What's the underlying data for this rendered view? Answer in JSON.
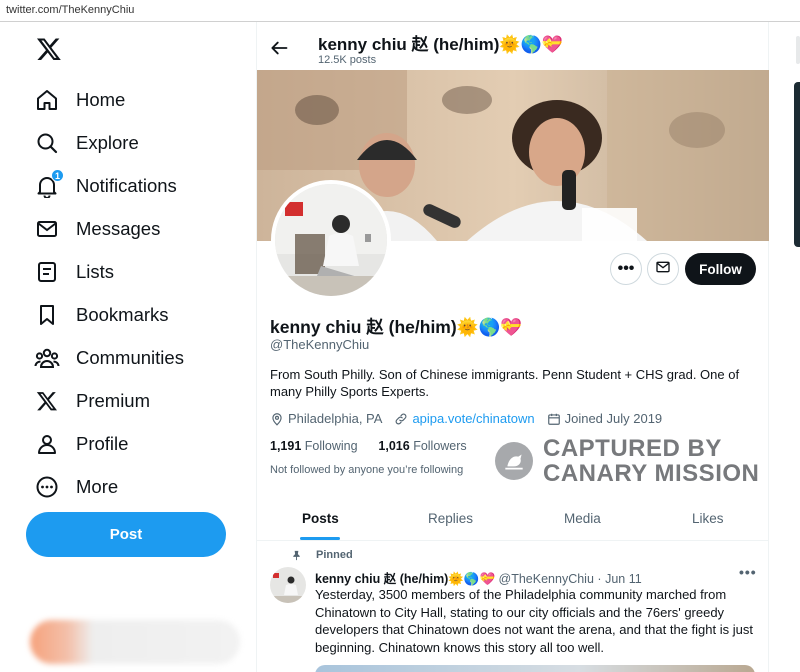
{
  "browser": {
    "url": "twitter.com/TheKennyChiu"
  },
  "sidebar": {
    "logo": "x-logo-icon",
    "items": [
      {
        "label": "Home",
        "icon": "home-icon"
      },
      {
        "label": "Explore",
        "icon": "search-icon"
      },
      {
        "label": "Notifications",
        "icon": "bell-icon",
        "badge": "1"
      },
      {
        "label": "Messages",
        "icon": "envelope-icon"
      },
      {
        "label": "Lists",
        "icon": "list-icon"
      },
      {
        "label": "Bookmarks",
        "icon": "bookmark-icon"
      },
      {
        "label": "Communities",
        "icon": "people-icon"
      },
      {
        "label": "Premium",
        "icon": "x-logo-icon"
      },
      {
        "label": "Profile",
        "icon": "person-icon"
      },
      {
        "label": "More",
        "icon": "more-circle-icon"
      }
    ],
    "post_label": "Post"
  },
  "header": {
    "name": "kenny chiu 赵 (he/him)🌞🌎💝",
    "post_count": "12.5K posts"
  },
  "profile": {
    "display_name": "kenny chiu 赵 (he/him)🌞🌎💝",
    "handle": "@TheKennyChiu",
    "bio": "From South Philly. Son of Chinese immigrants. Penn Student + CHS grad. One of many Philly Sports Experts.",
    "location": "Philadelphia, PA",
    "link": "apipa.vote/chinatown",
    "joined": "Joined July 2019",
    "following_count": "1,191",
    "following_label": "Following",
    "followers_count": "1,016",
    "followers_label": "Followers",
    "not_followed": "Not followed by anyone you’re following",
    "follow_label": "Follow",
    "more_glyph": "•••"
  },
  "watermark": {
    "line1": "CAPTURED BY",
    "line2": "CANARY MISSION"
  },
  "tabs": [
    "Posts",
    "Replies",
    "Media",
    "Likes"
  ],
  "tweet": {
    "pinned_label": "Pinned",
    "name": "kenny chiu 赵 (he/him)🌞🌎💝",
    "handle": "@TheKennyChiu",
    "separator": "·",
    "date": "Jun 11",
    "more_glyph": "•••",
    "text": "Yesterday, 3500 members of the Philadelphia community marched from Chinatown to City Hall, stating to our city officials and the 76ers' greedy developers that Chinatown does not want the arena, and that the fight is just beginning. Chinatown knows this story all too well."
  },
  "colors": {
    "accent": "#1d9bf0",
    "text": "#0f1419",
    "muted": "#536471",
    "follow_bg": "#0f1419"
  }
}
